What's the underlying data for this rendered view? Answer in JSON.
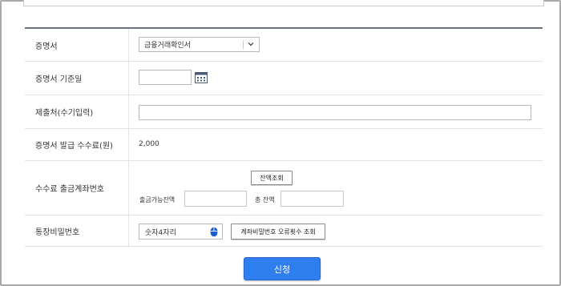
{
  "form": {
    "certificate_label": "증명서",
    "certificate_value": "금융거래확인서",
    "base_date_label": "증명서 기준일",
    "base_date_value": "",
    "recipient_label": "제출처(수기입력)",
    "recipient_value": "",
    "fee_label": "증명서 발급 수수료(원)",
    "fee_value": "2,000",
    "fee_account_label": "수수료 출금계좌번호",
    "balance_button": "잔액조회",
    "available_label": "출금가능잔액",
    "total_label": "총 잔액",
    "password_label": "통장비밀번호",
    "password_placeholder": "숫자4자리",
    "error_count_button": "계좌비밀번호 오류횟수 조회"
  },
  "submit_label": "신청",
  "colors": {
    "submit": "#2f7ef0",
    "calendar_icon": "#4a5a73",
    "mouse_icon": "#1e5fd0"
  },
  "icons": [
    "chevron-down-icon",
    "calendar-icon",
    "mouse-icon"
  ]
}
